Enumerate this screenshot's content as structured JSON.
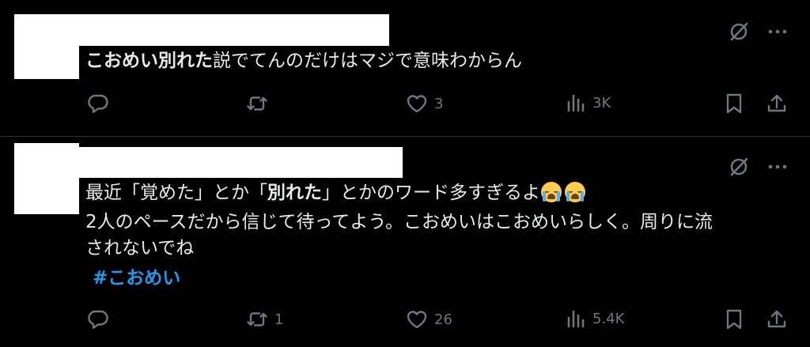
{
  "tweets": [
    {
      "body_bold": "こおめい別れた",
      "body_rest": "説でてんのだけはマジで意味わからん",
      "stats": {
        "replies": "",
        "reposts": "",
        "likes": "3",
        "views": "3K"
      }
    },
    {
      "line1_a": "最近「覚めた」とか「",
      "line1_bold": "別れた",
      "line1_b": "」とかのワード多すぎるよ",
      "emoji_name": "loudly-crying-face",
      "line2": "2人のペースだから信じて待ってよう。こおめいはこおめいらしく。周りに流",
      "line3": "されないでね",
      "hashtag": "#こおめい",
      "stats": {
        "replies": "",
        "reposts": "1",
        "likes": "26",
        "views": "5.4K"
      }
    }
  ],
  "colors": {
    "background": "#000000",
    "text": "#e7e9ea",
    "muted": "#71767b",
    "link": "#1d9bf0",
    "redaction": "#ffffff"
  },
  "icons": [
    "grok-icon",
    "more-icon",
    "reply-icon",
    "repost-icon",
    "like-icon",
    "views-icon",
    "bookmark-icon",
    "share-icon"
  ]
}
